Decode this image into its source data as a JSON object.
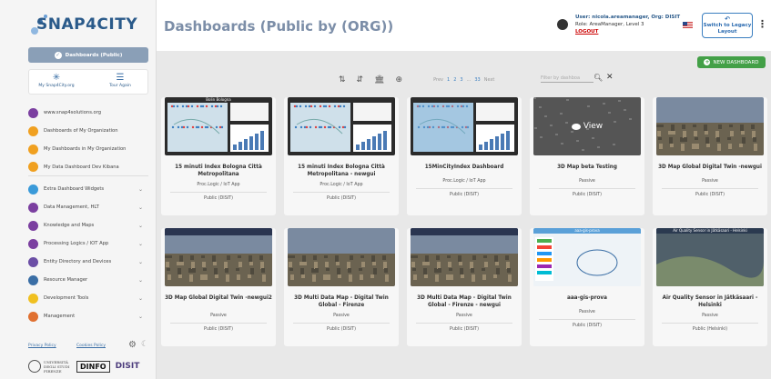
{
  "brand": {
    "name": "SNAP4CITY"
  },
  "header": {
    "title": "Dashboards (Public by (ORG))",
    "user_line": "User: nicola.areamanager, Org: DISIT",
    "role_line": "Role: AreaManager, Level 3",
    "logout": "LOGOUT",
    "legacy_button": "Switch to Legacy Layout"
  },
  "sidebar": {
    "active_button": "Dashboards (Public)",
    "quick": [
      {
        "label": "My Snap4City.org",
        "icon": "snap4city-logo-icon"
      },
      {
        "label": "Tour Again",
        "icon": "tour-icon"
      }
    ],
    "menu": [
      {
        "label": "www.snap4solutions.org",
        "color": "#7b3fa0",
        "chevron": false
      },
      {
        "label": "Dashboards of My Organization",
        "color": "#f0a020",
        "chevron": false
      },
      {
        "label": "My Dashboards in My Organization",
        "color": "#f0a020",
        "chevron": false
      },
      {
        "label": "My Data Dashboard Dev Kibana",
        "color": "#f0a020",
        "chevron": false
      },
      {
        "label": "Extra Dashboard Widgets",
        "color": "#3a9ad9",
        "chevron": true
      },
      {
        "label": "Data Management, HLT",
        "color": "#7b3fa0",
        "chevron": true
      },
      {
        "label": "Knowledge and Maps",
        "color": "#7b3fa0",
        "chevron": true
      },
      {
        "label": "Processing Logics / IOT App",
        "color": "#7b3fa0",
        "chevron": true
      },
      {
        "label": "Entity Directory and Devices",
        "color": "#6b4ea5",
        "chevron": true
      },
      {
        "label": "Resource Manager",
        "color": "#3a6ea5",
        "chevron": true
      },
      {
        "label": "Development Tools",
        "color": "#f0c020",
        "chevron": true
      },
      {
        "label": "Management",
        "color": "#e07030",
        "chevron": true
      }
    ],
    "privacy": "Privacy Policy",
    "cookies": "Cookies Policy",
    "footer": {
      "unifi": "UNIVERSITÀ DEGLI STUDI FIRENZE",
      "dinfo": "DINFO",
      "disit": "DISIT"
    }
  },
  "main": {
    "new_dashboard": "NEW DASHBOARD",
    "pager": {
      "prev": "Prev",
      "pages": [
        "1",
        "2",
        "3",
        "...",
        "33"
      ],
      "next": "Next"
    },
    "filter_placeholder": "Filter by dashboa",
    "cards": [
      {
        "title": "15 minuti Index Bologna Città Metropolitana",
        "type": "Proc.Logic / IoT App",
        "org": "Public (DISIT)",
        "thumb": "map",
        "thumb_title": "Bolin Bologna"
      },
      {
        "title": "15 minuti Index Bologna Città Metropolitana - newgui",
        "type": "Proc.Logic / IoT App",
        "org": "Public (DISIT)",
        "thumb": "map2",
        "thumb_title": ""
      },
      {
        "title": "15MinCityIndex Dashboard",
        "type": "Proc.Logic / IoT App",
        "org": "Public (DISIT)",
        "thumb": "map3",
        "thumb_title": ""
      },
      {
        "title": "3D Map beta Testing",
        "type": "Passive",
        "org": "Public (DISIT)",
        "thumb": "dark",
        "thumb_title": "",
        "overlay": "View"
      },
      {
        "title": "3D Map Global Digital Twin -newgui",
        "type": "Passive",
        "org": "Public (DISIT)",
        "thumb": "city",
        "thumb_title": ""
      },
      {
        "title": "3D Map Global Digital Twin -newgui2",
        "type": "Passive",
        "org": "Public (DISIT)",
        "thumb": "city2",
        "thumb_title": ""
      },
      {
        "title": "3D Multi Data Map - Digital Twin Global - Firenze",
        "type": "Passive",
        "org": "Public (DISIT)",
        "thumb": "city3",
        "thumb_title": ""
      },
      {
        "title": "3D Multi Data Map - Digital Twin Global - Firenze - newgui",
        "type": "Passive",
        "org": "Public (DISIT)",
        "thumb": "city4",
        "thumb_title": ""
      },
      {
        "title": "aaa-gis-prova",
        "type": "Passive",
        "org": "Public (DISIT)",
        "thumb": "gis",
        "thumb_title": "aaa-gis-prova"
      },
      {
        "title": "Air Quality Sensor in Jätkäsaari - Helsinki",
        "type": "Passive",
        "org": "Public (Helsinki)",
        "thumb": "sat",
        "thumb_title": "Air Quality Sensor in Jätkäsaari - Helsinki"
      }
    ]
  }
}
